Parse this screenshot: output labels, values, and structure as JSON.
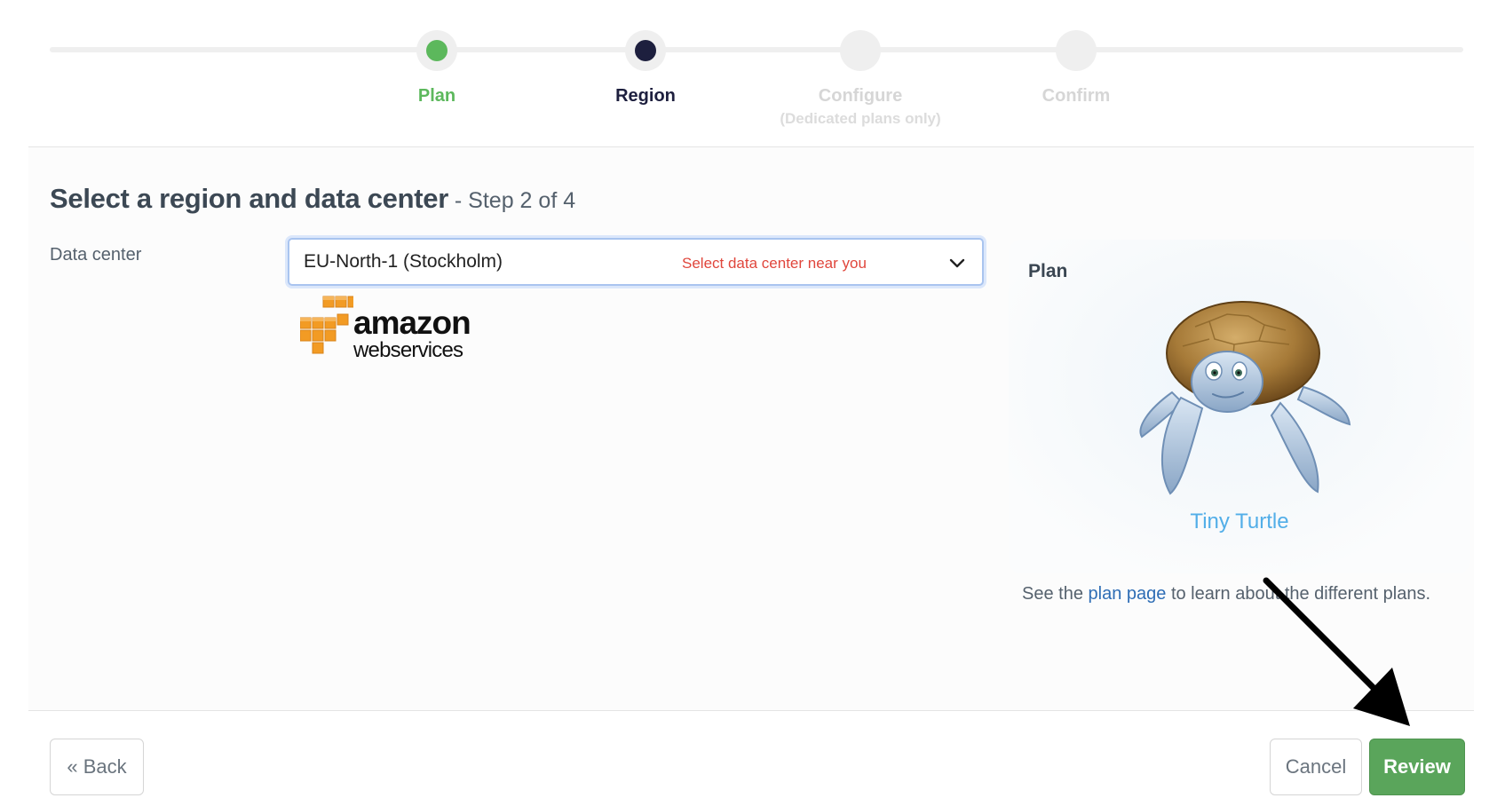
{
  "stepper": {
    "steps": [
      {
        "label": "Plan",
        "sublabel": "",
        "state": "done"
      },
      {
        "label": "Region",
        "sublabel": "",
        "state": "active"
      },
      {
        "label": "Configure",
        "sublabel": "(Dedicated plans only)",
        "state": "todo"
      },
      {
        "label": "Confirm",
        "sublabel": "",
        "state": "todo"
      }
    ]
  },
  "heading": {
    "title": "Select a region and data center",
    "step_text": " - Step 2 of 4"
  },
  "data_center": {
    "label": "Data center",
    "selected_value": "EU-North-1 (Stockholm)",
    "hint": "Select data center near you",
    "provider_logo_text": "amazon web services"
  },
  "plan": {
    "title": "Plan",
    "name": "Tiny Turtle",
    "note_before": "See the ",
    "note_link": "plan page",
    "note_after": " to learn about the different plans."
  },
  "footer": {
    "back_label": "« Back",
    "cancel_label": "Cancel",
    "review_label": "Review"
  },
  "colors": {
    "done": "#5cb85c",
    "active": "#1d1f3e",
    "hint_red": "#e0463c",
    "link_blue": "#2e6db5",
    "plan_name": "#52aee8",
    "review_green": "#5aa55b"
  },
  "icons": {
    "dropdown": "chevron-down-icon",
    "annotation": "arrow-icon"
  }
}
